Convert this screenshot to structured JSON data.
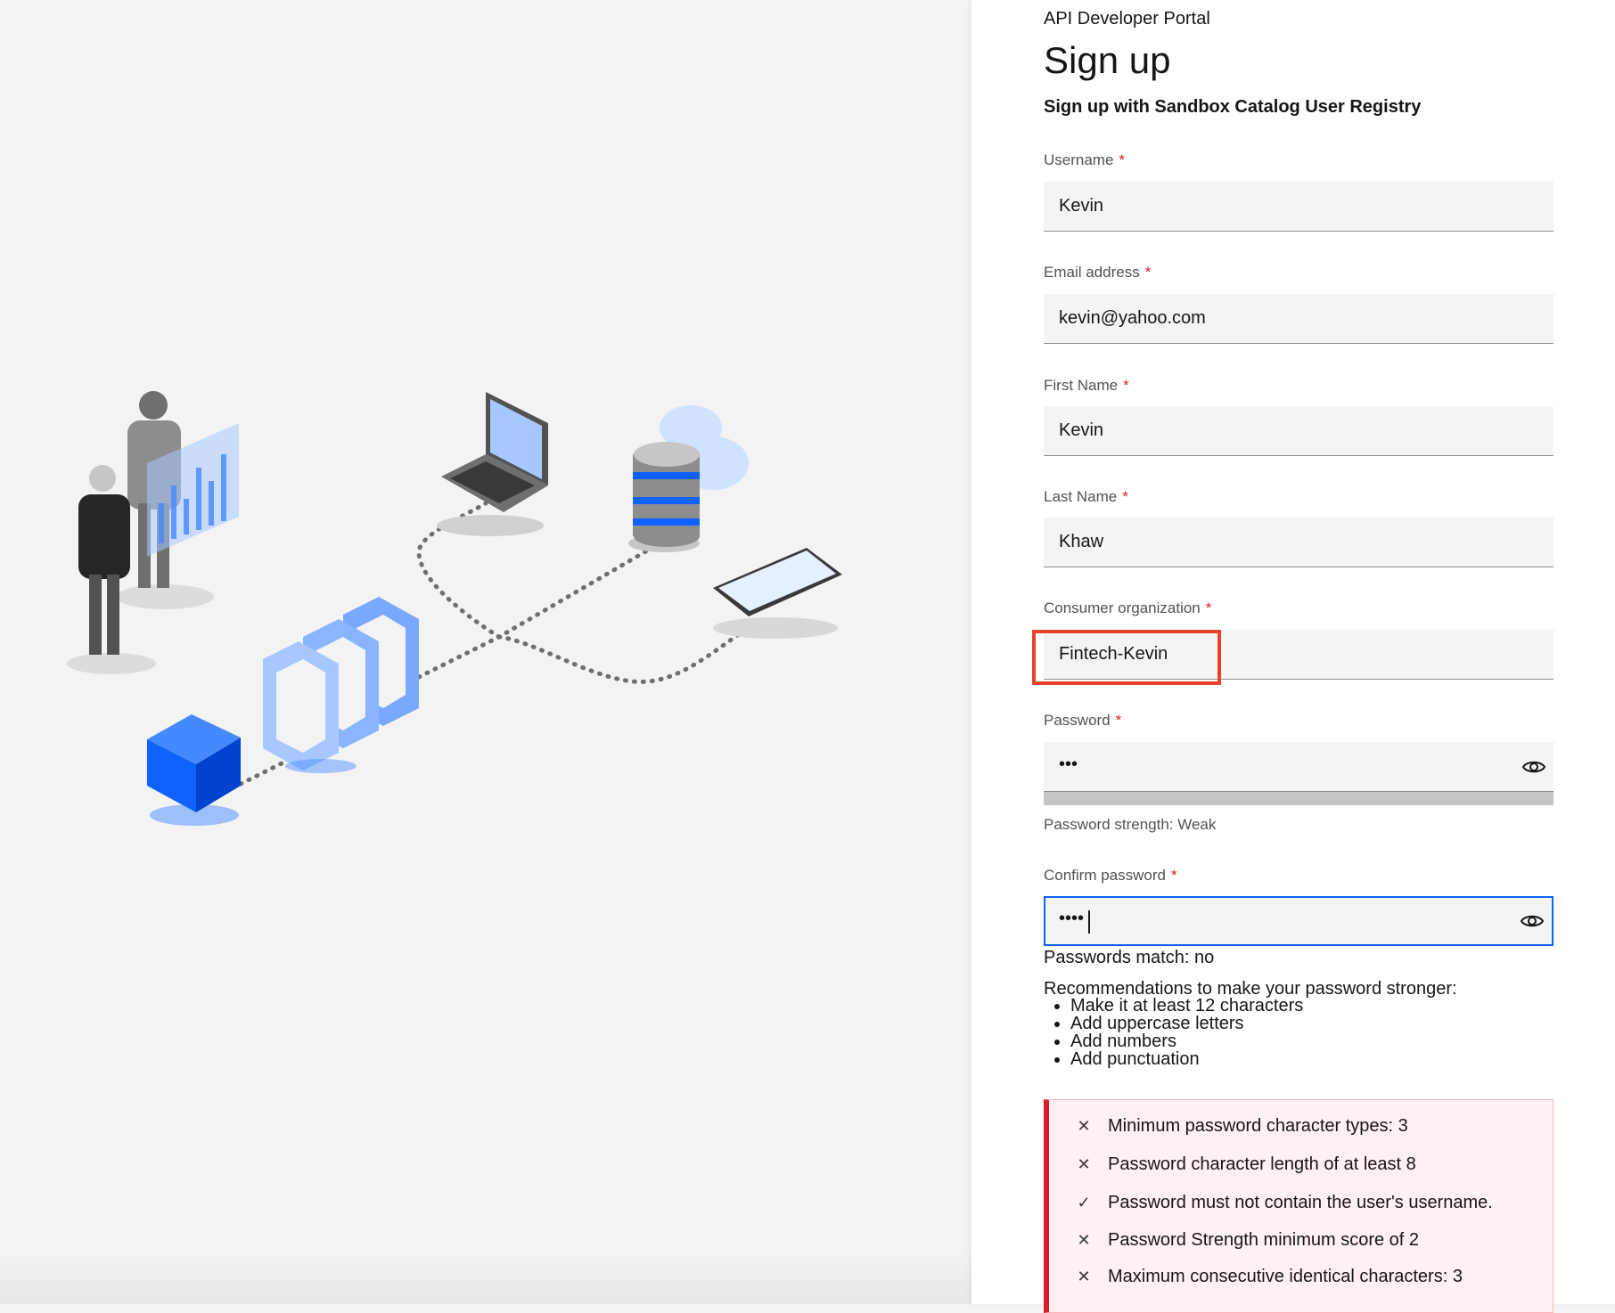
{
  "header": {
    "portal_name": "API Developer Portal",
    "title": "Sign up",
    "subtitle": "Sign up with Sandbox Catalog User Registry"
  },
  "form": {
    "username": {
      "label": "Username",
      "required": "*",
      "value": "Kevin"
    },
    "email": {
      "label": "Email address",
      "required": "*",
      "value": "kevin@yahoo.com"
    },
    "first_name": {
      "label": "First Name",
      "required": "*",
      "value": "Kevin"
    },
    "last_name": {
      "label": "Last Name",
      "required": "*",
      "value": "Khaw"
    },
    "consumer_org": {
      "label": "Consumer organization",
      "required": "*",
      "value": "Fintech-Kevin"
    },
    "password": {
      "label": "Password",
      "required": "*",
      "value": "•••",
      "strength_text": "Password strength: Weak",
      "icon": "eye-icon"
    },
    "confirm_password": {
      "label": "Confirm password",
      "required": "*",
      "value": "••••",
      "icon": "eye-icon"
    },
    "match_text": "Passwords match: no",
    "recommendations_title": "Recommendations to make your password stronger:",
    "recommendations": [
      "Make it at least 12 characters",
      "Add uppercase letters",
      "Add numbers",
      "Add punctuation"
    ],
    "rules": [
      {
        "text": "Minimum password character types: 3",
        "status": "fail",
        "mark": "✕"
      },
      {
        "text": "Password character length of at least 8",
        "status": "fail",
        "mark": "✕"
      },
      {
        "text": "Password must not contain the user's username.",
        "status": "pass",
        "mark": "✓"
      },
      {
        "text": "Password Strength minimum score of 2",
        "status": "fail",
        "mark": "✕"
      },
      {
        "text": "Maximum consecutive identical characters: 3",
        "status": "fail",
        "mark": "✕"
      }
    ]
  },
  "colors": {
    "error": "#da1e28",
    "focus": "#0f62fe",
    "highlight": "#e8422d",
    "illustration_blue": "#0f62fe"
  }
}
